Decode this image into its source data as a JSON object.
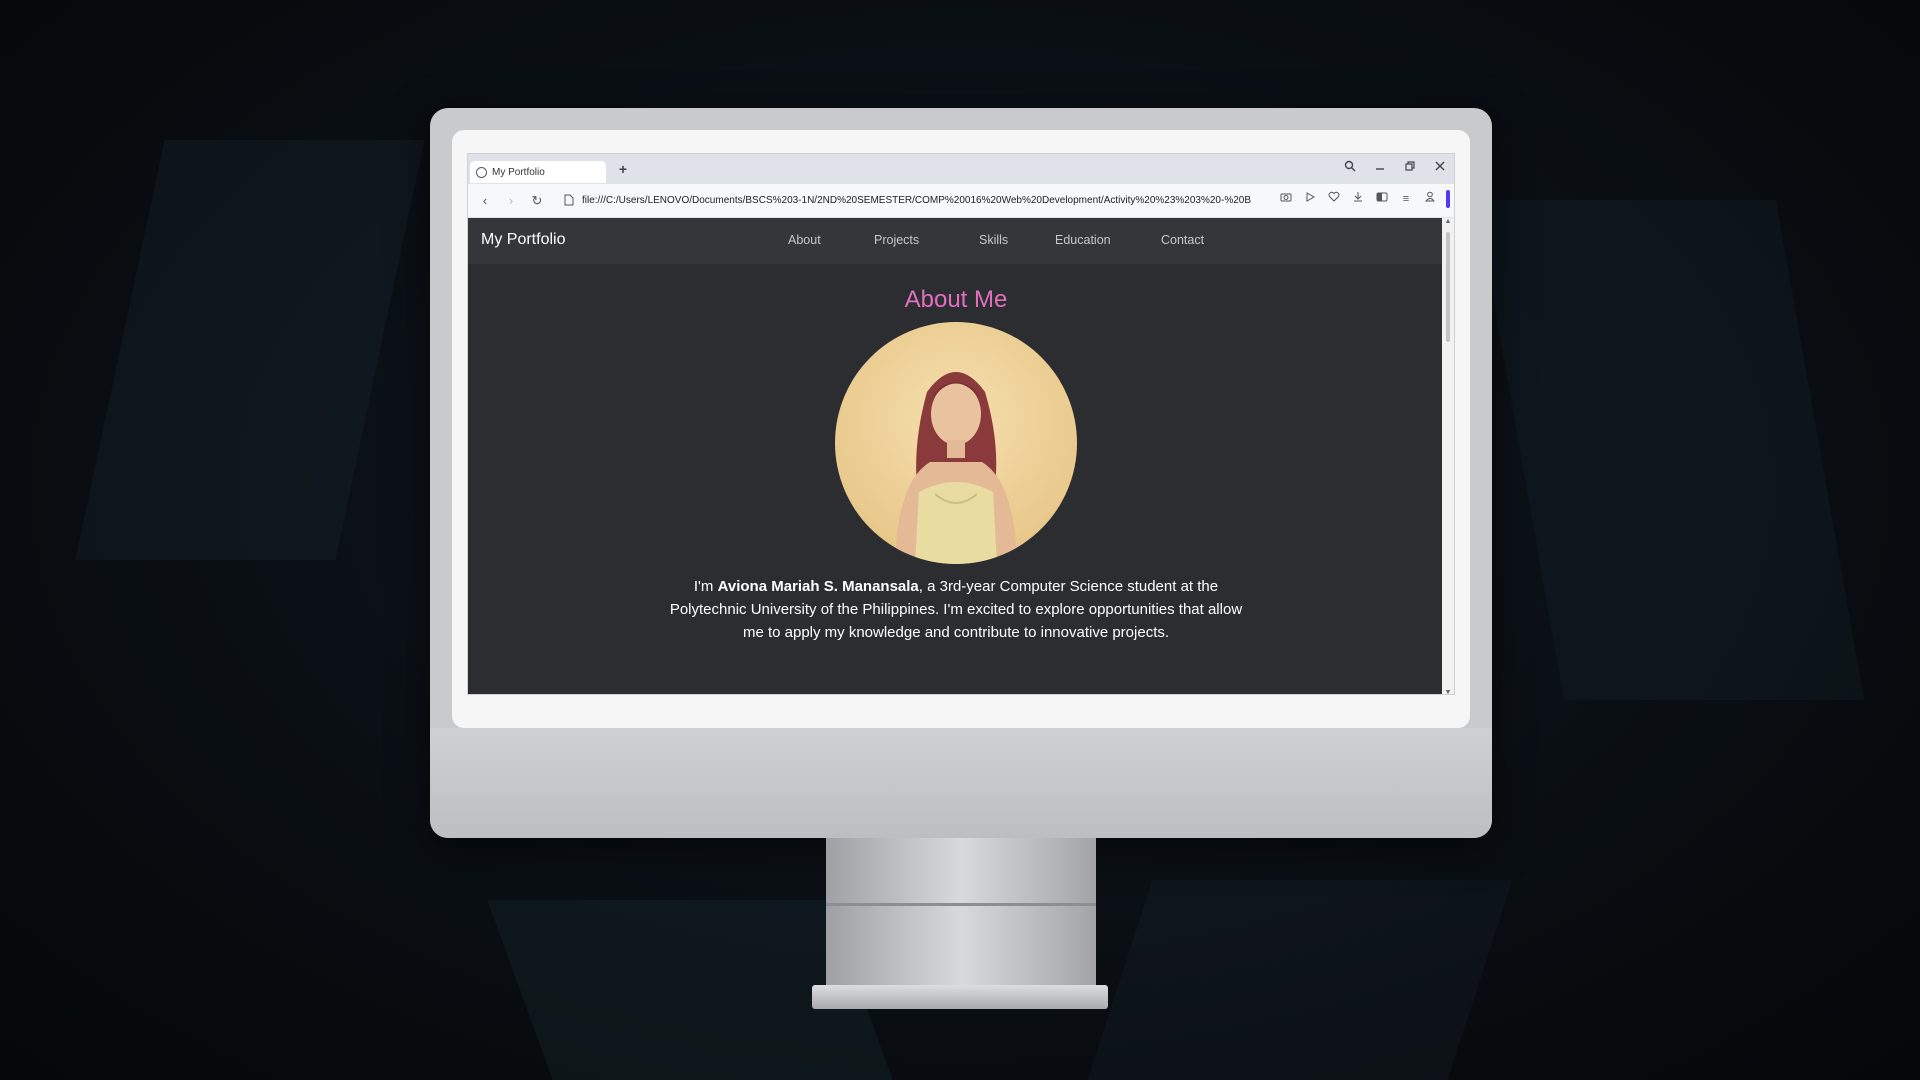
{
  "browser": {
    "tab_title": "My Portfolio",
    "new_tab": "+",
    "url": "file:///C:/Users/LENOVO/Documents/BSCS%203-1N/2ND%20SEMESTER/COMP%20016%20Web%20Development/Activity%20%23%203%20-%20B",
    "icons": {
      "tab": "globe-icon",
      "search": "search-icon",
      "minimize": "minimize-icon",
      "restore": "restore-icon",
      "close": "close-icon",
      "back": "back-arrow-icon",
      "forward": "forward-arrow-icon",
      "reload": "reload-icon",
      "page": "page-icon",
      "screenshot": "camera-icon",
      "play": "play-icon",
      "favorite": "heart-icon",
      "download": "download-icon",
      "sidebar": "sidebar-icon",
      "menu": "menu-icon",
      "profile": "profile-icon"
    },
    "accent_color": "#4f3cf0"
  },
  "site": {
    "brand": "My Portfolio",
    "nav": [
      "About",
      "Projects",
      "Skills",
      "Education",
      "Contact"
    ],
    "section_title": "About Me",
    "title_color": "#e26fbe",
    "bio": {
      "prefix": "I'm ",
      "name": "Aviona Mariah S. Manansala",
      "rest": ", a 3rd-year Computer Science student at the Polytechnic University of the Philippines. I'm excited to explore opportunities that allow me to apply my knowledge and contribute to innovative projects."
    },
    "background_color": "#2b2d31"
  }
}
